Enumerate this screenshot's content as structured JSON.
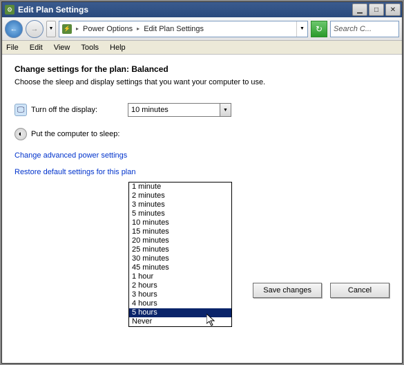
{
  "window": {
    "title": "Edit Plan Settings"
  },
  "address": {
    "crumb1": "Power Options",
    "crumb2": "Edit Plan Settings"
  },
  "search": {
    "placeholder": "Search C..."
  },
  "menubar": {
    "file": "File",
    "edit": "Edit",
    "view": "View",
    "tools": "Tools",
    "help": "Help"
  },
  "page": {
    "heading": "Change settings for the plan: Balanced",
    "subtext": "Choose the sleep and display settings that you want your computer to use."
  },
  "settings": {
    "display_off_label": "Turn off the display:",
    "display_off_value": "10 minutes",
    "sleep_label": "Put the computer to sleep:"
  },
  "dropdown_options": [
    "1 minute",
    "2 minutes",
    "3 minutes",
    "5 minutes",
    "10 minutes",
    "15 minutes",
    "20 minutes",
    "25 minutes",
    "30 minutes",
    "45 minutes",
    "1 hour",
    "2 hours",
    "3 hours",
    "4 hours",
    "5 hours",
    "Never"
  ],
  "dropdown_selected": "5 hours",
  "links": {
    "advanced": "Change advanced power settings",
    "restore": "Restore default settings for this plan"
  },
  "buttons": {
    "save": "Save changes",
    "cancel": "Cancel"
  }
}
